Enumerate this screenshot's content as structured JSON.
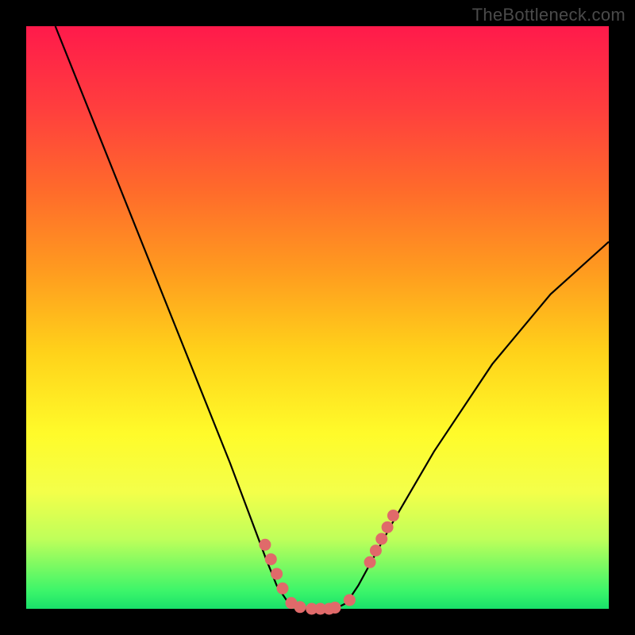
{
  "watermark": "TheBottleneck.com",
  "chart_data": {
    "type": "line",
    "title": "",
    "xlabel": "",
    "ylabel": "",
    "xlim": [
      0,
      100
    ],
    "ylim": [
      0,
      100
    ],
    "grid": false,
    "legend": false,
    "series": [
      {
        "name": "curve",
        "x": [
          5,
          15,
          25,
          35,
          41,
          43,
          45,
          47,
          49,
          51,
          53,
          55,
          57,
          63,
          70,
          80,
          90,
          100
        ],
        "y": [
          100,
          75,
          50,
          25,
          9,
          4,
          1,
          0,
          0,
          0,
          0,
          1,
          4,
          15,
          27,
          42,
          54,
          63
        ]
      }
    ],
    "marker_points": [
      {
        "x": 41.0,
        "y": 11.0
      },
      {
        "x": 42.0,
        "y": 8.5
      },
      {
        "x": 43.0,
        "y": 6.0
      },
      {
        "x": 44.0,
        "y": 3.5
      },
      {
        "x": 45.5,
        "y": 1.0
      },
      {
        "x": 47.0,
        "y": 0.3
      },
      {
        "x": 49.0,
        "y": 0.0
      },
      {
        "x": 50.5,
        "y": 0.0
      },
      {
        "x": 52.0,
        "y": 0.0
      },
      {
        "x": 53.0,
        "y": 0.2
      },
      {
        "x": 55.5,
        "y": 1.5
      },
      {
        "x": 59.0,
        "y": 8.0
      },
      {
        "x": 60.0,
        "y": 10.0
      },
      {
        "x": 61.0,
        "y": 12.0
      },
      {
        "x": 62.0,
        "y": 14.0
      },
      {
        "x": 63.0,
        "y": 16.0
      }
    ],
    "colors": {
      "curve_stroke": "#000000",
      "marker_fill": "#e06a6a"
    }
  }
}
